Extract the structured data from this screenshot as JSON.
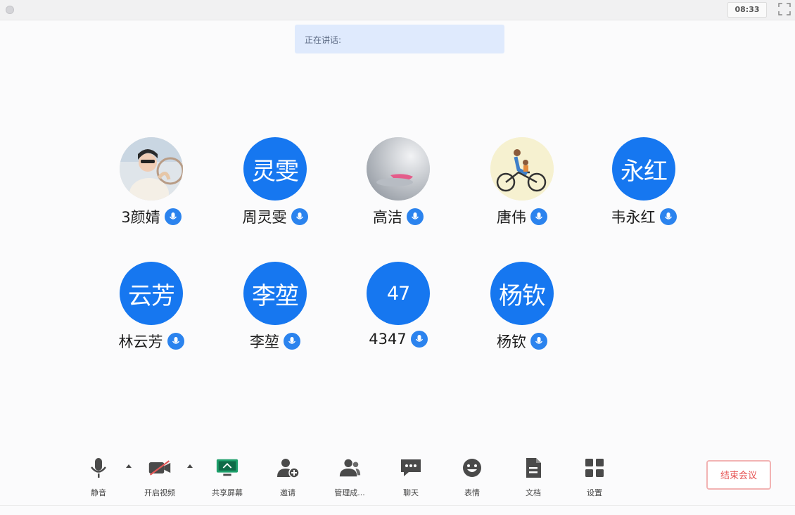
{
  "window": {
    "timer": "08:33"
  },
  "speaking": {
    "label": "正在讲话:"
  },
  "participants": [
    {
      "name": "3颜婧",
      "avatar_text": "",
      "avatar_type": "photo-woman"
    },
    {
      "name": "周灵雯",
      "avatar_text": "灵雯",
      "avatar_type": "text"
    },
    {
      "name": "高洁",
      "avatar_text": "",
      "avatar_type": "photo-object"
    },
    {
      "name": "唐伟",
      "avatar_text": "",
      "avatar_type": "photo-bicycle"
    },
    {
      "name": "韦永红",
      "avatar_text": "永红",
      "avatar_type": "text"
    },
    {
      "name": "林云芳",
      "avatar_text": "云芳",
      "avatar_type": "text"
    },
    {
      "name": "李堃",
      "avatar_text": "李堃",
      "avatar_type": "text"
    },
    {
      "name": "4347",
      "avatar_text": "47",
      "avatar_type": "text"
    },
    {
      "name": "杨钦",
      "avatar_text": "杨钦",
      "avatar_type": "text"
    }
  ],
  "toolbar": {
    "mute": "静音",
    "camera": "开启视频",
    "share": "共享屏幕",
    "invite": "邀请",
    "manage": "管理成...",
    "chat": "聊天",
    "reactions": "表情",
    "docs": "文档",
    "settings": "设置"
  },
  "end_meeting": "结束会议",
  "colors": {
    "accent": "#1677f0",
    "end": "#e65050",
    "speaking_bg": "#dfeafd"
  },
  "icons": [
    "mic-icon",
    "camera-off-icon",
    "share-screen-icon",
    "invite-icon",
    "manage-members-icon",
    "chat-icon",
    "emoji-icon",
    "document-icon",
    "settings-icon",
    "fullscreen-icon"
  ]
}
